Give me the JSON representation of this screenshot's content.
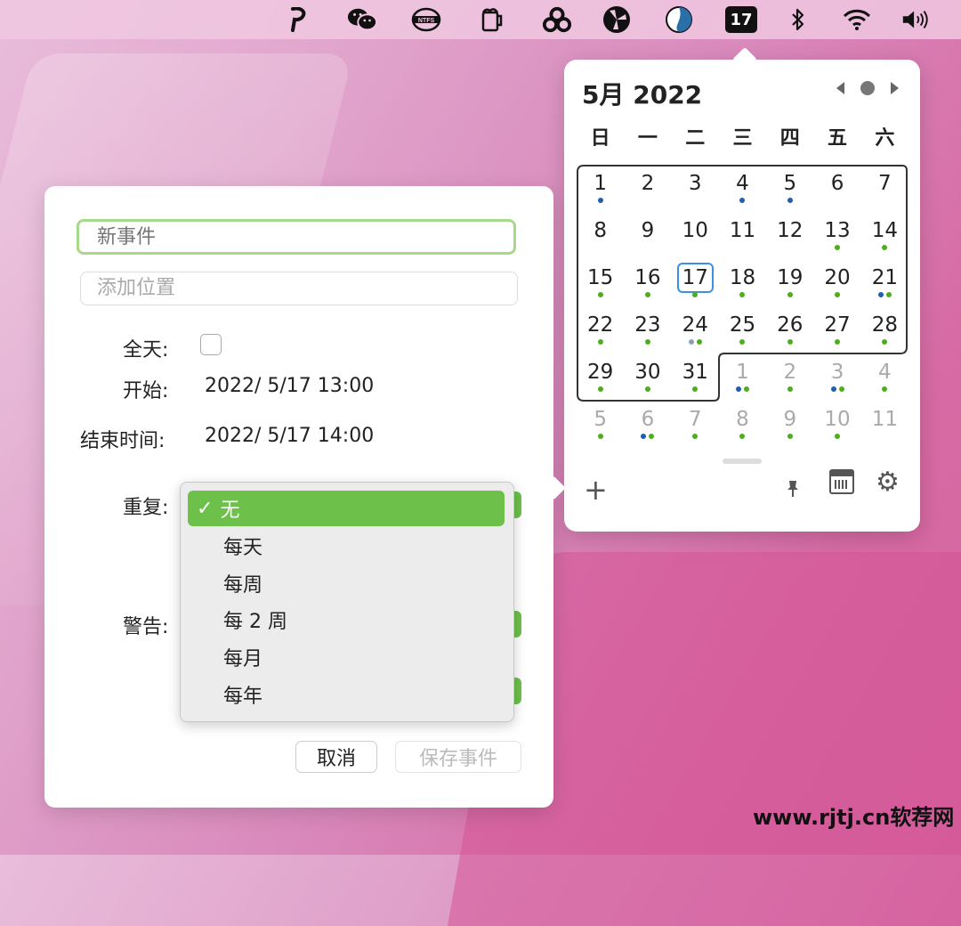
{
  "menubar": {
    "icons": [
      "pocket-p-icon",
      "wechat-icon",
      "ntfs-icon",
      "mug-icon",
      "rings-icon",
      "fan-icon",
      "browser-icon",
      "calendar-date-icon",
      "bluetooth-icon",
      "wifi-icon",
      "volume-icon"
    ],
    "ntfs_label": "NTFS",
    "calendar_day": "17"
  },
  "calendar": {
    "title": "5月 2022",
    "weekdays": [
      "日",
      "一",
      "二",
      "三",
      "四",
      "五",
      "六"
    ],
    "today": 17,
    "colors": {
      "green": "#4caf1a",
      "blue": "#1e5fb4",
      "gray": "#8aa0b8",
      "today": "#3b8fe6"
    },
    "days": [
      {
        "n": "1",
        "other": false,
        "dots": [
          "blue"
        ]
      },
      {
        "n": "2",
        "other": false,
        "dots": []
      },
      {
        "n": "3",
        "other": false,
        "dots": []
      },
      {
        "n": "4",
        "other": false,
        "dots": [
          "blue"
        ]
      },
      {
        "n": "5",
        "other": false,
        "dots": [
          "blue"
        ]
      },
      {
        "n": "6",
        "other": false,
        "dots": []
      },
      {
        "n": "7",
        "other": false,
        "dots": []
      },
      {
        "n": "8",
        "other": false,
        "dots": []
      },
      {
        "n": "9",
        "other": false,
        "dots": []
      },
      {
        "n": "10",
        "other": false,
        "dots": []
      },
      {
        "n": "11",
        "other": false,
        "dots": []
      },
      {
        "n": "12",
        "other": false,
        "dots": []
      },
      {
        "n": "13",
        "other": false,
        "dots": [
          "green"
        ]
      },
      {
        "n": "14",
        "other": false,
        "dots": [
          "green"
        ]
      },
      {
        "n": "15",
        "other": false,
        "dots": [
          "green"
        ]
      },
      {
        "n": "16",
        "other": false,
        "dots": [
          "green"
        ]
      },
      {
        "n": "17",
        "other": false,
        "dots": [
          "green"
        ],
        "today": true
      },
      {
        "n": "18",
        "other": false,
        "dots": [
          "green"
        ]
      },
      {
        "n": "19",
        "other": false,
        "dots": [
          "green"
        ]
      },
      {
        "n": "20",
        "other": false,
        "dots": [
          "green"
        ]
      },
      {
        "n": "21",
        "other": false,
        "dots": [
          "blue",
          "green"
        ]
      },
      {
        "n": "22",
        "other": false,
        "dots": [
          "green"
        ]
      },
      {
        "n": "23",
        "other": false,
        "dots": [
          "green"
        ]
      },
      {
        "n": "24",
        "other": false,
        "dots": [
          "gray",
          "green"
        ]
      },
      {
        "n": "25",
        "other": false,
        "dots": [
          "green"
        ]
      },
      {
        "n": "26",
        "other": false,
        "dots": [
          "green"
        ]
      },
      {
        "n": "27",
        "other": false,
        "dots": [
          "green"
        ]
      },
      {
        "n": "28",
        "other": false,
        "dots": [
          "green"
        ]
      },
      {
        "n": "29",
        "other": false,
        "dots": [
          "green"
        ]
      },
      {
        "n": "30",
        "other": false,
        "dots": [
          "green"
        ]
      },
      {
        "n": "31",
        "other": false,
        "dots": [
          "green"
        ]
      },
      {
        "n": "1",
        "other": true,
        "dots": [
          "blue",
          "green"
        ]
      },
      {
        "n": "2",
        "other": true,
        "dots": [
          "green"
        ]
      },
      {
        "n": "3",
        "other": true,
        "dots": [
          "blue",
          "green"
        ]
      },
      {
        "n": "4",
        "other": true,
        "dots": [
          "green"
        ]
      },
      {
        "n": "5",
        "other": true,
        "dots": [
          "green"
        ]
      },
      {
        "n": "6",
        "other": true,
        "dots": [
          "blue",
          "green"
        ]
      },
      {
        "n": "7",
        "other": true,
        "dots": [
          "green"
        ]
      },
      {
        "n": "8",
        "other": true,
        "dots": [
          "green"
        ]
      },
      {
        "n": "9",
        "other": true,
        "dots": [
          "green"
        ]
      },
      {
        "n": "10",
        "other": true,
        "dots": [
          "green"
        ]
      },
      {
        "n": "11",
        "other": true,
        "dots": []
      }
    ]
  },
  "event": {
    "title_placeholder": "新事件",
    "location_placeholder": "添加位置",
    "allday_label": "全天:",
    "start_label": "开始:",
    "start_value": "2022/  5/17 13:00",
    "end_label": "结束时间:",
    "end_value": "2022/  5/17 14:00",
    "repeat_label": "重复:",
    "alert_label": "警告:",
    "cancel_label": "取消",
    "save_label": "保存事件"
  },
  "repeat_menu": {
    "checkmark": "✓",
    "items": [
      "无",
      "每天",
      "每周",
      "每 2 周",
      "每月",
      "每年"
    ],
    "selected": 0,
    "accent": "#6dc04a"
  },
  "watermark": "www.rjtj.cn软荐网"
}
